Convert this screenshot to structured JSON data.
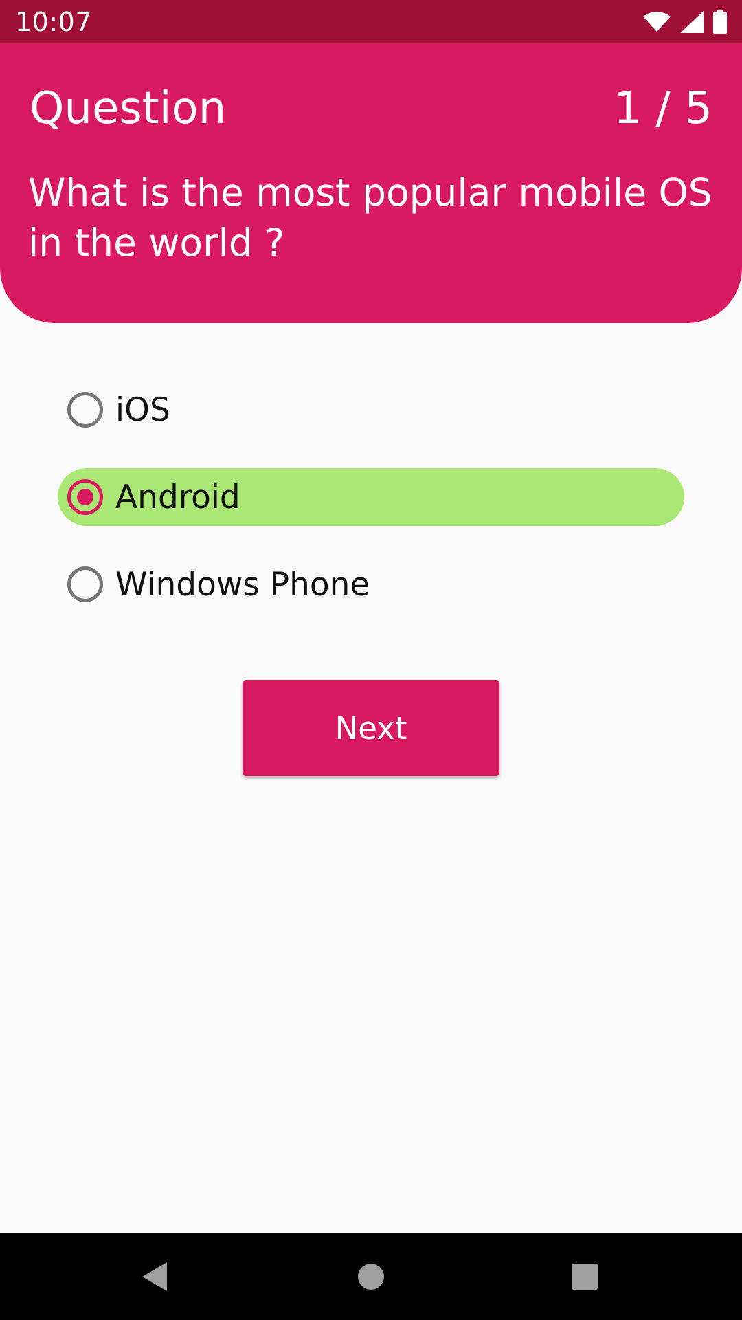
{
  "status_bar": {
    "time": "10:07",
    "icons": [
      "wifi-icon",
      "signal-icon",
      "battery-icon"
    ]
  },
  "header": {
    "title": "Question",
    "counter": "1 / 5",
    "question": "What is the most popular mobile OS in the world ?"
  },
  "options": [
    {
      "label": "iOS",
      "selected": false
    },
    {
      "label": "Android",
      "selected": true
    },
    {
      "label": "Windows Phone",
      "selected": false
    }
  ],
  "next_button": {
    "label": "Next"
  },
  "nav_bar": {
    "icons": [
      "back-icon",
      "home-icon",
      "recents-icon"
    ]
  },
  "colors": {
    "status_bar": "#9e1036",
    "primary": "#d81b60",
    "selected_option": "#abe775",
    "background": "#fafafa",
    "nav_bar": "#000000"
  }
}
